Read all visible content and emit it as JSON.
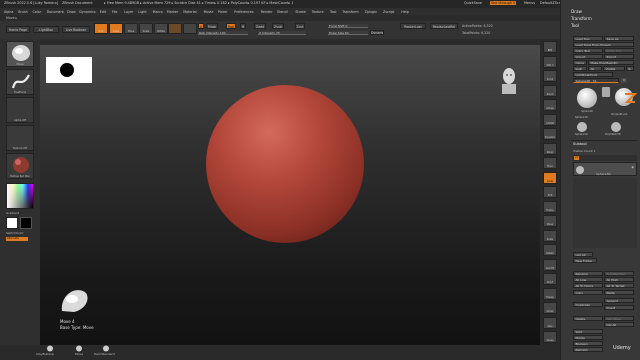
{
  "titlebar": {
    "app": "ZBrush 2022.0.6 [Luky Romero]",
    "document": "ZBrush Document",
    "status": "▸ Free Mem 9.489GB ▸ Active Mem 729 ▸ Scratch Disk 41 ▸ Timer▸ 0.182 ▸ PolyCount▸ 0.197 KP ▸ MeshCount▸ 1",
    "quicksave": "QuickSave",
    "seethrough": "See-through 0",
    "menus": "Menus",
    "script": "DefaultZScript"
  },
  "menubar": [
    "Alpha",
    "Brush",
    "Color",
    "Document",
    "Draw",
    "Dynamics",
    "Edit",
    "File",
    "Layer",
    "Light",
    "Macro",
    "Marker",
    "Material",
    "Movie",
    "Picker",
    "Preferences",
    "Render",
    "Stencil",
    "Stroke",
    "Texture",
    "Tool",
    "Transform",
    "Zplugin",
    "Zscript",
    "Help"
  ],
  "subbar": {
    "label": "Move ▸"
  },
  "toolbar": {
    "home_page": "Home Page",
    "lightbox": "LightBox",
    "live_boolean": "Live Boolean",
    "edit": "Edit",
    "draw": "Draw",
    "move": "Move",
    "scale": "Scale",
    "rotate": "Rotate",
    "a_label": "A",
    "mrgb": "Mrgb",
    "rgb": "Rgb",
    "m": "M",
    "zadd": "Zadd",
    "zsub": "Zsub",
    "zcut": "Zcut",
    "rgb_intensity": "Rgb Intensity 100",
    "z_intensity": "Z Intensity 25",
    "focal_shift": "Focal Shift 0",
    "draw_size": "Draw Size 64",
    "dynamic": "Dynamic",
    "replay_last": "ReplayLast",
    "replay_last_rel": "ReplayLastRel",
    "active_points": "ActivePoints: 6,320",
    "total_points": "TotalPoints: 6,320"
  },
  "left_shelf": {
    "brush_label": "Move",
    "stroke_label": "FreeHand",
    "alpha_label": "Alpha Off",
    "texture_label": "Texture Off",
    "material_label": "MatCap Red Wax",
    "gradient_label": "Gradient",
    "switch_color": "SwitchColor",
    "alternate": "Alternate"
  },
  "canvas": {
    "brush_name": "Move",
    "brush_size": "4",
    "base_type": "Base Type: Move",
    "sphere_color": "#b3473a"
  },
  "right_shelf": [
    "BPR",
    "SPix 3",
    "Scroll",
    "Zoom",
    "Actual",
    "AAHalf",
    "Dynamic",
    "Persp",
    "Floor",
    "Local",
    "XYZ",
    "Frame",
    "Move",
    "Scale",
    "Rotate",
    "Line Fill",
    "PolyF",
    "Transp",
    "Ghost",
    "Solo",
    "Xpose"
  ],
  "bottom_brushes": [
    "ClayBuildup",
    "Move",
    "DamStandard"
  ],
  "panel": {
    "draw": "Draw",
    "transform": "Transform",
    "tool": "Tool",
    "load_tool": "Load Tool",
    "save_as": "Save As",
    "load_tools_from_project": "Load Tools From Project",
    "copy_tool": "Copy Tool",
    "paste_tool": "Paste Tool",
    "import": "Import",
    "export": "Export",
    "clone": "Clone",
    "make_polymesh3d": "Make PolyMesh3D",
    "goz": "GoZ",
    "all": "All",
    "visible": "Visible",
    "r": "R",
    "lightbox_tools": "Lightbox▸Tools",
    "sphere_slider": "Sphere3D_ 31",
    "tool_thumbs": [
      "Sphere3D",
      "Cylinder3D",
      "Sphere3D",
      "SimpleBrush",
      "Sphere3D",
      "PolyMesh3D"
    ],
    "subtool": "Subtool",
    "visible_count": "Visible Count 1",
    "subtool_item": "Sphere3D",
    "list_all": "List All",
    "new_folder": "New Folder",
    "rename": "Rename",
    "autoreorder": "AutoReorder",
    "all_low": "All Low",
    "all_high": "All High",
    "all_to_home": "All To Home",
    "all_to_target": "All To Target",
    "copy": "Copy",
    "paste": "Paste",
    "duplicate": "Duplicate",
    "append": "Append",
    "insert": "Insert",
    "delete": "Delete",
    "del_other": "Del Other",
    "del_all": "Del All",
    "split": "Split",
    "merge": "Merge",
    "boolean": "Boolean",
    "remesh": "Remesh",
    "udemy": "Udemy"
  },
  "colors": {
    "accent": "#e07a1f",
    "main_color": "#ffffff",
    "secondary_color": "#000000"
  }
}
